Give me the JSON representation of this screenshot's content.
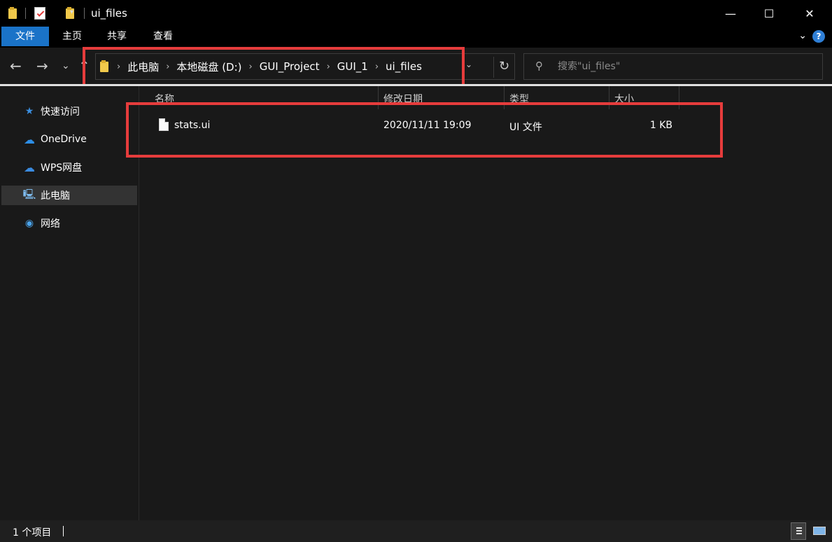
{
  "window": {
    "title": "ui_files",
    "controls": {
      "minimize": "—",
      "maximize": "☐",
      "close": "✕"
    }
  },
  "ribbon": {
    "tabs": [
      "文件",
      "主页",
      "共享",
      "查看"
    ],
    "help": "?"
  },
  "nav": {
    "back": "←",
    "forward": "→",
    "recent": "⌄",
    "up": "↑"
  },
  "address": {
    "segments": [
      "此电脑",
      "本地磁盘 (D:)",
      "GUI_Project",
      "GUI_1",
      "ui_files"
    ],
    "separator": "›",
    "refresh": "↻",
    "dropdown": "⌄"
  },
  "search": {
    "placeholder": "搜索\"ui_files\""
  },
  "sidebar": {
    "items": [
      {
        "label": "快速访问",
        "icon": "star-icon"
      },
      {
        "label": "OneDrive",
        "icon": "cloud-icon"
      },
      {
        "label": "WPS网盘",
        "icon": "cloud-outline-icon"
      },
      {
        "label": "此电脑",
        "icon": "computer-icon",
        "active": true
      },
      {
        "label": "网络",
        "icon": "network-icon"
      }
    ]
  },
  "columns": [
    "名称",
    "修改日期",
    "类型",
    "大小"
  ],
  "files": [
    {
      "name": "stats.ui",
      "modified": "2020/11/11 19:09",
      "type": "UI 文件",
      "size": "1 KB"
    }
  ],
  "status": {
    "count": "1 个项目"
  },
  "colors": {
    "accent": "#1a73c8",
    "highlight": "#e63c3c",
    "background": "#191919"
  }
}
